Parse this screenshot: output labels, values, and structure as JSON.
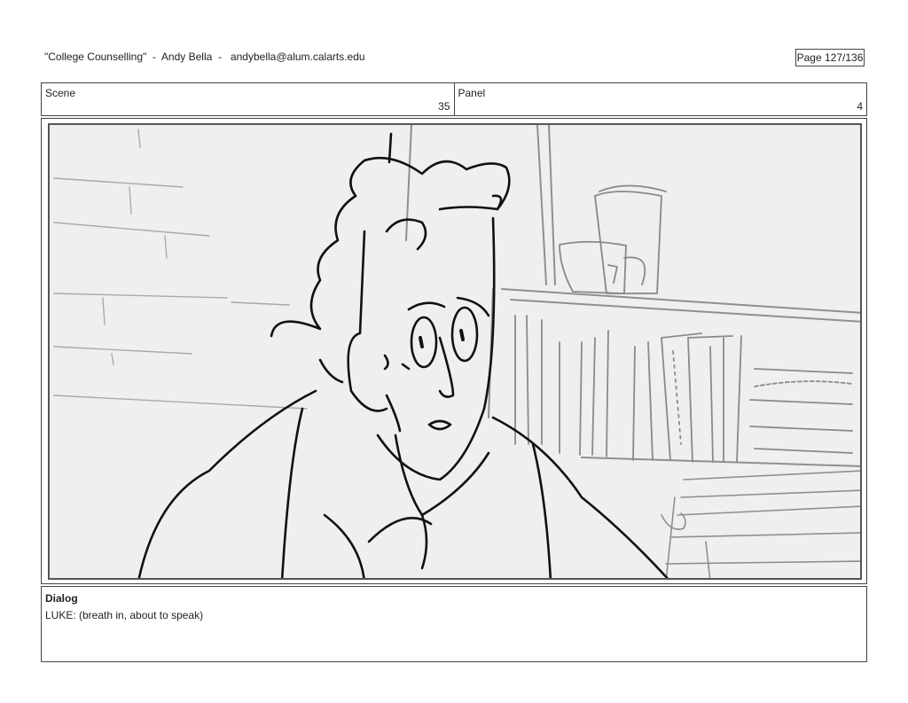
{
  "header": {
    "title": "\"College Counselling\"  -  Andy Bella  -   andybella@alum.calarts.edu",
    "page": "Page 127/136"
  },
  "scene": {
    "label": "Scene",
    "value": "35"
  },
  "panel": {
    "label": "Panel",
    "value": "4"
  },
  "dialog": {
    "label": "Dialog",
    "text": "LUKE: (breath in, about to speak)"
  }
}
